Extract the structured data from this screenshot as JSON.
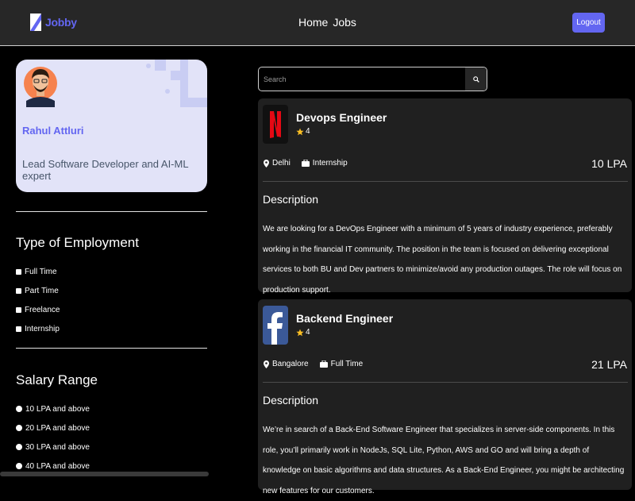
{
  "nav": {
    "logo_text": "Jobby",
    "links": [
      "Home",
      "Jobs"
    ],
    "logout_label": "Logout",
    "accent_color": "#6366f1"
  },
  "profile": {
    "name": "Rahul Attluri",
    "bio": "Lead Software Developer and AI-ML expert"
  },
  "filters": {
    "employment_title": "Type of Employment",
    "employment_options": [
      "Full Time",
      "Part Time",
      "Freelance",
      "Internship"
    ],
    "salary_title": "Salary Range",
    "salary_options": [
      "10 LPA and above",
      "20 LPA and above",
      "30 LPA and above",
      "40 LPA and above"
    ]
  },
  "search": {
    "placeholder": "Search",
    "button_icon": "search-icon"
  },
  "jobs": [
    {
      "company_icon": "netflix-logo",
      "title": "Devops Engineer",
      "rating": "4",
      "location": "Delhi",
      "employment_type": "Internship",
      "package": "10 LPA",
      "description_heading": "Description",
      "description": "We are looking for a DevOps Engineer with a minimum of 5 years of industry experience, preferably working in the financial IT community. The position in the team is focused on delivering exceptional services to both BU and Dev partners to minimize/avoid any production outages. The role will focus on production support."
    },
    {
      "company_icon": "facebook-logo",
      "title": "Backend Engineer",
      "rating": "4",
      "location": "Bangalore",
      "employment_type": "Full Time",
      "package": "21 LPA",
      "description_heading": "Description",
      "description": "We’re in search of a Back-End Software Engineer that specializes in server-side components. In this role, you’ll primarily work in NodeJs, SQL Lite, Python, AWS and GO and will bring a depth of knowledge on basic algorithms and data structures. As a Back-End Engineer, you might be architecting new features for our customers."
    }
  ]
}
